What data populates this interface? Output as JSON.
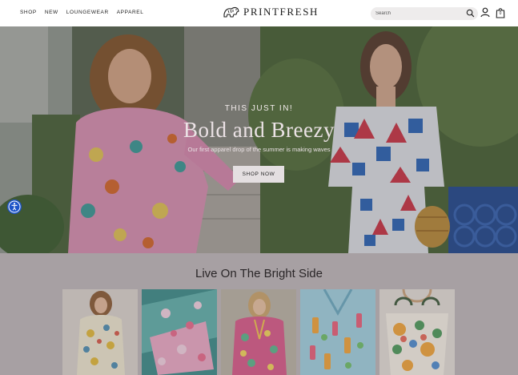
{
  "header": {
    "nav": [
      "SHOP",
      "NEW",
      "LOUNGEWEAR",
      "APPAREL"
    ],
    "logo_text": "PRINTFRESH",
    "search_placeholder": "Search",
    "cart_count": "0"
  },
  "hero": {
    "kicker": "THIS JUST IN!",
    "title": "Bold and Breezy",
    "subtitle": "Our first apparel drop of the summer is making waves",
    "button": "SHOP NOW"
  },
  "section": {
    "title": "Live On The Bright Side"
  },
  "products": [
    {
      "name": "floral-pajama-model-card"
    },
    {
      "name": "folded-pajama-card"
    },
    {
      "name": "tunic-model-card"
    },
    {
      "name": "cocktail-print-shirt-card"
    },
    {
      "name": "tote-bag-card"
    }
  ],
  "colors": {
    "accessibility_button": "#1d54c9",
    "header_bg": "#ffffff",
    "page_bg": "#a7a0a3"
  },
  "icons": [
    "logo-tiger-icon",
    "search-icon",
    "account-icon",
    "bag-icon",
    "accessibility-icon"
  ]
}
